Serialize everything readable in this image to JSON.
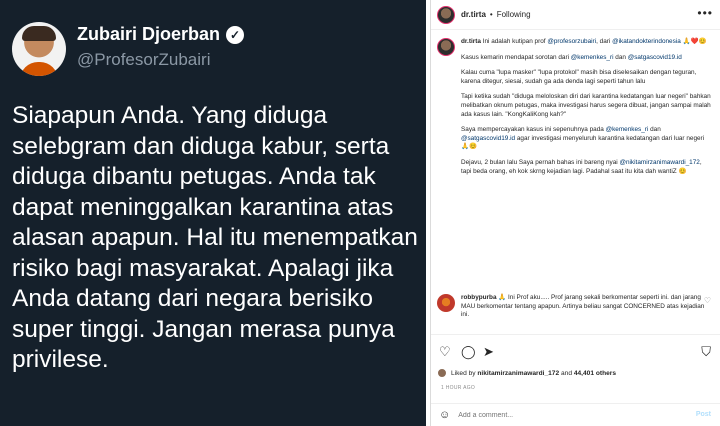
{
  "tweet": {
    "name": "Zubairi Djoerban",
    "handle": "@ProfesorZubairi",
    "text": "Siapapun Anda. Yang diduga selebgram dan diduga kabur, serta diduga dibantu petugas. Anda tak dapat meninggalkan karantina atas alasan apapun. Hal itu menempatkan risiko bagi masyarakat. Apalagi jika Anda datang dari negara berisiko super tinggi. Jangan merasa punya privilese.",
    "verified_icon": "verified-badge-icon"
  },
  "instagram": {
    "header": {
      "username": "dr.tirta",
      "separator": "•",
      "follow_label": "Following",
      "more_icon": "more-options-icon"
    },
    "caption": {
      "username": "dr.tirta",
      "p1_text": "Ini adalah kutipan prof",
      "p1_link1": "@profesorzubairi",
      "p1_mid": ", dari",
      "p1_link2": "@ikatandokterindonesia",
      "p1_hearts": "🙏❤️😊",
      "p2_text": "Kasus kemarin mendapat sorotan dari",
      "p2_link1": "@kemenkes_ri",
      "p2_mid": "dan",
      "p2_link2": "@satgascovid19.id",
      "p3": "Kalau cuma \"lupa masker\" \"lupa protokol\" masih bisa diselesaikan dengan teguran, karena ditegur, siesai, sudah ga ada denda lagi seperti tahun lalu",
      "p4": "Tapi ketika sudah \"diduga meloloskan diri dari karantina kedatangan luar negeri\" bahkan melibatkan oknum petugas, maka investigasi harus segera dibuat, jangan sampai malah ada kasus lain. \"KongKaliKong kah?\"",
      "p5_text": "Saya mempercayakan kasus ini sepenuhnya pada",
      "p5_link1": "@kemenkes_ri",
      "p5_mid": "dan",
      "p5_link2": "@satgascovid19.id",
      "p5_end": "agar investigasi menyeluruh karantina kedatangan dari luar negeri",
      "p5_emoji": "🙏😊",
      "p6_text": "Dejavu, 2 bulan lalu Saya pernah bahas ini bareng nyai",
      "p6_link": "@nikitamirzanimawardi_172",
      "p6_end": ", tapi beda orang, eh kok skrng kejadian lagi. Padahal saat itu kita dah wantiZ",
      "p6_emoji": "😊"
    },
    "comment": {
      "username": "robbypurba",
      "text": "🙏 Ini Prof aku..... Prof jarang sekali berkomentar seperti ini. dan jarang MAU berkomentar tentang apapun. Artinya beliau sangat CONCERNED atas kejadian ini."
    },
    "actions": {
      "like_icon": "heart-icon",
      "comment_icon": "comment-icon",
      "share_icon": "share-icon",
      "save_icon": "bookmark-icon"
    },
    "likes": {
      "prefix": "Liked by",
      "user": "nikitamirzanimawardi_172",
      "mid": "and",
      "count": "44,401 others"
    },
    "time": "1 HOUR AGO",
    "add_comment": {
      "placeholder": "Add a comment...",
      "post_label": "Post"
    }
  }
}
